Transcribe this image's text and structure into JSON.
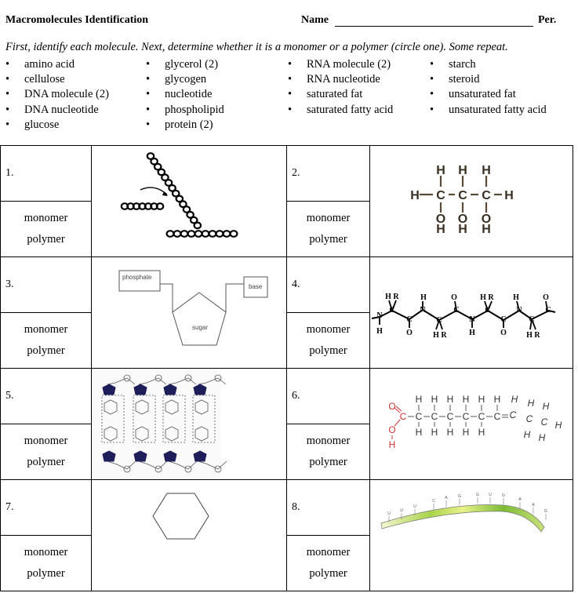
{
  "header": {
    "title": "Macromolecules Identification",
    "name_label": "Name",
    "period_label": "Per."
  },
  "instructions": "First, identify each molecule.  Next, determine whether it is a monomer or a polymer (circle one).  Some repeat.",
  "word_bank": {
    "columns": [
      [
        "amino acid",
        "cellulose",
        "DNA molecule (2)",
        "DNA nucleotide",
        "glucose"
      ],
      [
        "glycerol (2)",
        "glycogen",
        "nucleotide",
        "phospholipid",
        "protein (2)"
      ],
      [
        "RNA molecule (2)",
        "RNA nucleotide",
        "saturated fat",
        "saturated fatty acid"
      ],
      [
        "starch",
        "steroid",
        "unsaturated fat",
        "unsaturated fatty acid"
      ]
    ]
  },
  "choices": {
    "monomer": "monomer",
    "polymer": "polymer"
  },
  "items": [
    {
      "number": "1.",
      "image": "branched-polysaccharide-chain"
    },
    {
      "number": "2.",
      "image": "glycerol-structure"
    },
    {
      "number": "3.",
      "image": "nucleotide-diagram",
      "labels": {
        "phosphate": "phosphate",
        "sugar": "sugar",
        "base": "base"
      }
    },
    {
      "number": "4.",
      "image": "polypeptide-backbone"
    },
    {
      "number": "5.",
      "image": "dna-double-strand"
    },
    {
      "number": "6.",
      "image": "unsaturated-fatty-acid"
    },
    {
      "number": "7.",
      "image": "hexagon-ring"
    },
    {
      "number": "8.",
      "image": "rna-strand",
      "bases": [
        "U",
        "U",
        "U",
        "C",
        "A",
        "G",
        "G",
        "U",
        "G",
        "A",
        "A",
        "G"
      ]
    }
  ],
  "colors": {
    "carboxyl_red": "#cc3333",
    "bond_brown": "#5a4a38",
    "strand_green": "#8cc63f",
    "pentose_navy": "#1e1e5a"
  }
}
